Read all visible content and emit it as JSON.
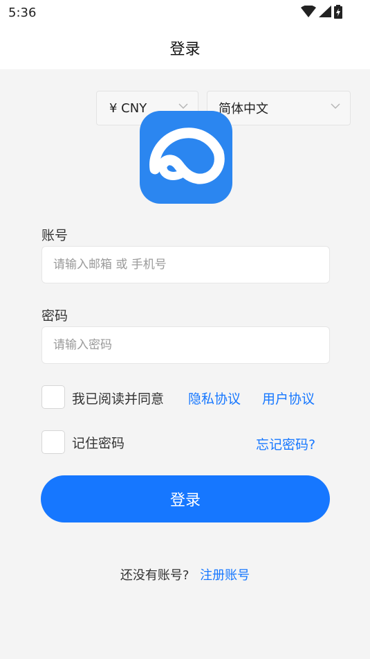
{
  "status": {
    "time": "5:36"
  },
  "header": {
    "title": "登录"
  },
  "currency": {
    "value": "¥ CNY"
  },
  "language": {
    "value": "简体中文"
  },
  "account": {
    "label": "账号",
    "placeholder": "请输入邮箱 或 手机号",
    "value": ""
  },
  "password": {
    "label": "密码",
    "placeholder": "请输入密码",
    "value": ""
  },
  "agreement": {
    "text": "我已阅读并同意",
    "privacy": "隐私协议",
    "user": "用户协议",
    "checked": false
  },
  "remember": {
    "text": "记住密码",
    "forgot": "忘记密码?",
    "checked": false
  },
  "login_button": "登录",
  "register": {
    "text": "还没有账号?",
    "link": "注册账号"
  },
  "colors": {
    "primary": "#1677ff",
    "logo": "#2b86f0",
    "background": "#f4f4f4"
  },
  "icons": [
    "wifi-icon",
    "signal-icon",
    "battery-icon",
    "chevron-down-icon",
    "app-logo-icon"
  ]
}
